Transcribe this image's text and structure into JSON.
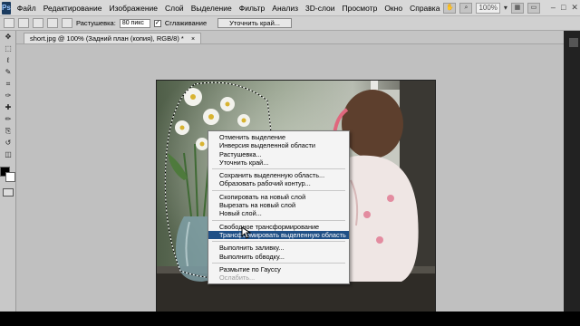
{
  "menubar": {
    "logo": "Ps",
    "items": [
      "Файл",
      "Редактирование",
      "Изображение",
      "Слой",
      "Выделение",
      "Фильтр",
      "Анализ",
      "3D-слои",
      "Просмотр",
      "Окно",
      "Справка"
    ],
    "zoom": "100%"
  },
  "options": {
    "feather_label": "Растушевка:",
    "feather_value": "80 пикс",
    "antialias_label": "Сглаживание",
    "refine_button": "Уточнить край..."
  },
  "document": {
    "tab_title": "short.jpg @ 100% (Задний план (копия), RGB/8) *",
    "close": "×"
  },
  "context_menu": {
    "items": [
      {
        "label": "Отменить выделение",
        "state": "normal"
      },
      {
        "label": "Инверсия выделенной области",
        "state": "normal"
      },
      {
        "label": "Растушевка...",
        "state": "normal"
      },
      {
        "label": "Уточнить край...",
        "state": "normal"
      },
      {
        "sep": true
      },
      {
        "label": "Сохранить выделенную область...",
        "state": "normal"
      },
      {
        "label": "Образовать рабочий контур...",
        "state": "normal"
      },
      {
        "sep": true
      },
      {
        "label": "Скопировать на новый слой",
        "state": "normal"
      },
      {
        "label": "Вырезать на новый слой",
        "state": "normal"
      },
      {
        "label": "Новый слой...",
        "state": "normal"
      },
      {
        "sep": true
      },
      {
        "label": "Свободное трансформирование",
        "state": "normal"
      },
      {
        "label": "Трансформировать выделенную область",
        "state": "active"
      },
      {
        "sep": true
      },
      {
        "label": "Выполнить заливку...",
        "state": "normal"
      },
      {
        "label": "Выполнить обводку...",
        "state": "normal"
      },
      {
        "sep": true
      },
      {
        "label": "Размытие по Гауссу",
        "state": "normal"
      },
      {
        "label": "Ослабить...",
        "state": "disabled"
      }
    ]
  },
  "colors": {
    "accent": "#1f4f86",
    "workspace": "#c0c0c0",
    "menubar": "#d8d8d8"
  },
  "icons": {
    "tools": [
      "move-icon",
      "marquee-icon",
      "lasso-icon",
      "quick-select-icon",
      "crop-icon",
      "eyedropper-icon",
      "healing-icon",
      "brush-icon",
      "stamp-icon",
      "history-brush-icon",
      "eraser-icon",
      "gradient-icon",
      "blur-icon",
      "dodge-icon",
      "pen-icon",
      "type-icon",
      "path-select-icon",
      "shape-icon",
      "hand-icon",
      "zoom-icon"
    ]
  }
}
